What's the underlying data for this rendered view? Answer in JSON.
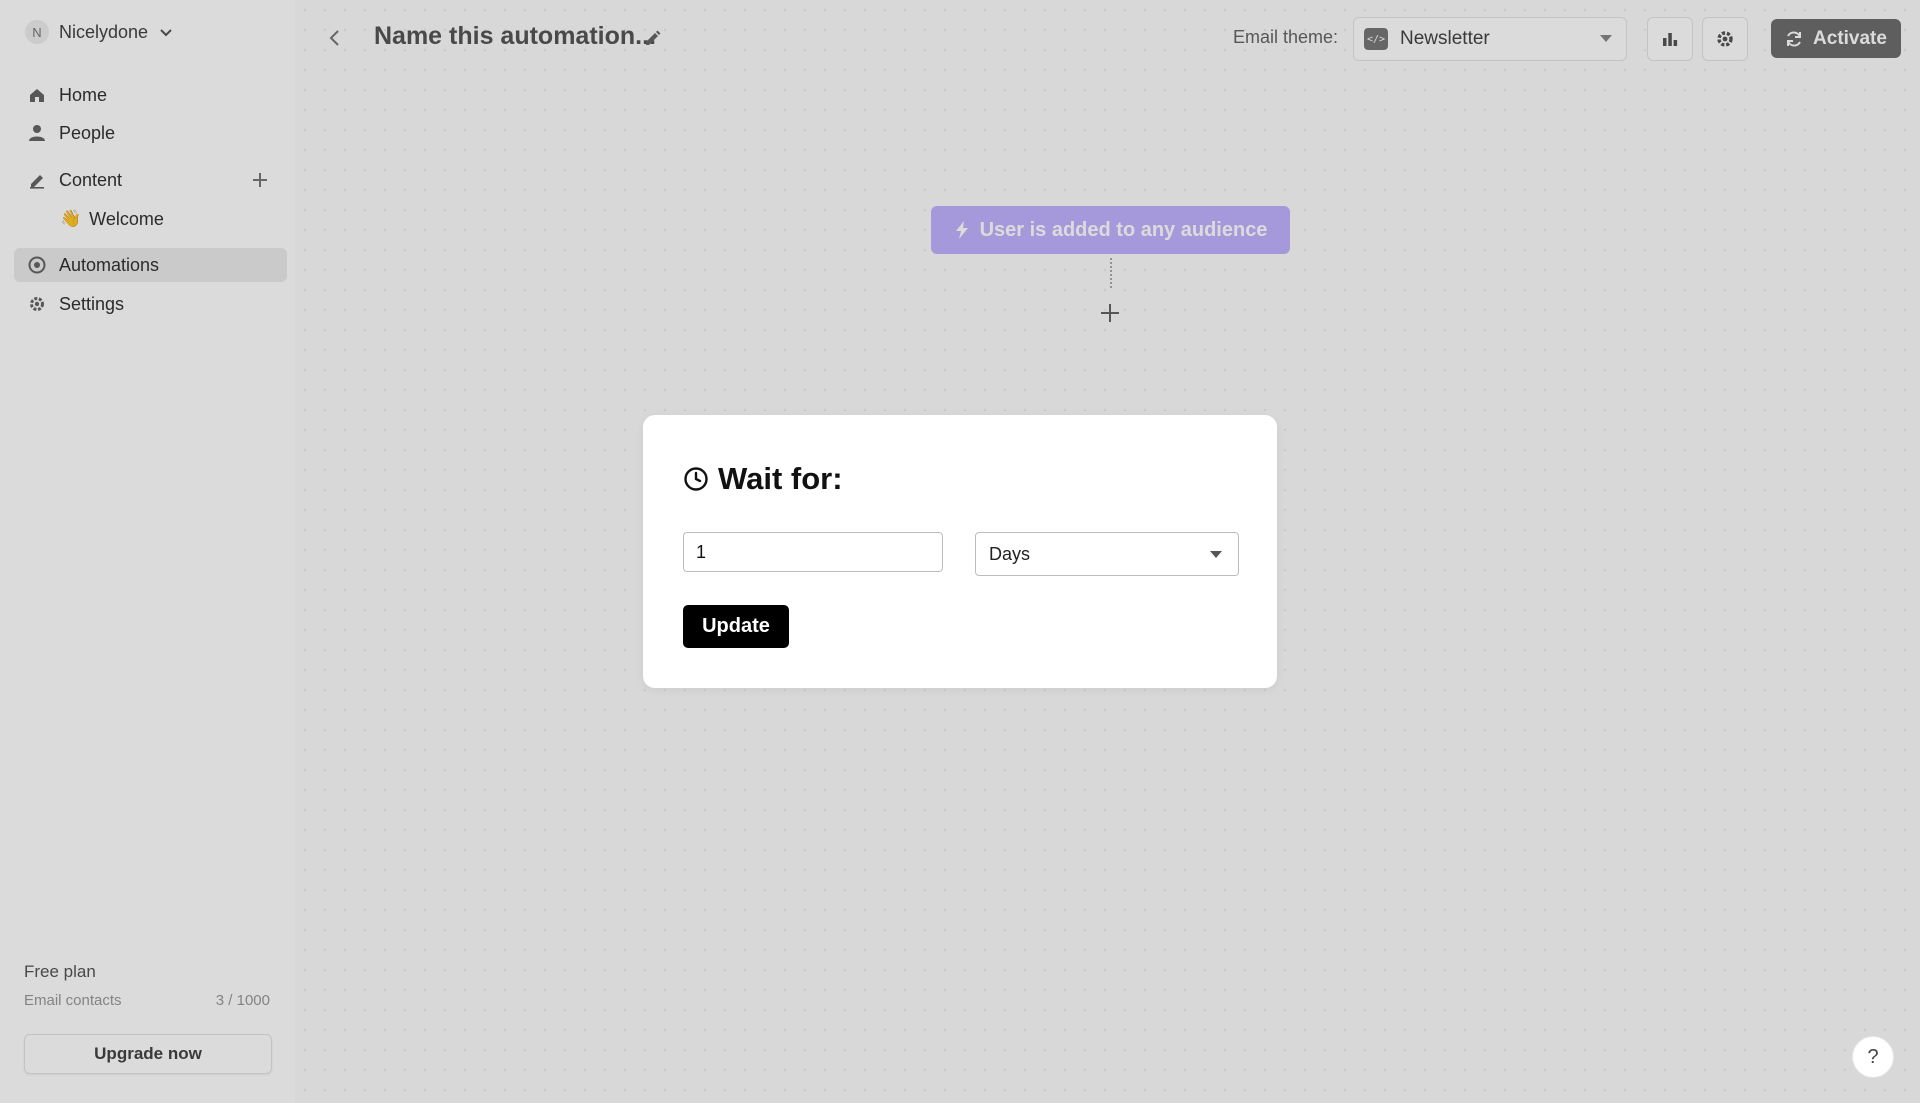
{
  "workspace": {
    "initial": "N",
    "name": "Nicelydone"
  },
  "sidebar": {
    "items": [
      {
        "label": "Home",
        "icon": "home-icon"
      },
      {
        "label": "People",
        "icon": "person-icon"
      },
      {
        "label": "Content",
        "icon": "edit-icon"
      },
      {
        "label": "Welcome",
        "icon": "wave-emoji"
      },
      {
        "label": "Automations",
        "icon": "automation-icon"
      },
      {
        "label": "Settings",
        "icon": "gear-icon"
      }
    ],
    "plan": {
      "title": "Free plan",
      "metric_label": "Email contacts",
      "metric_value": "3 / 1000",
      "upgrade_label": "Upgrade now"
    }
  },
  "topbar": {
    "title": "Name this automation...",
    "theme_label": "Email theme:",
    "theme_value": "Newsletter",
    "theme_code_glyph": "</>",
    "activate_label": "Activate"
  },
  "canvas": {
    "trigger_label": "User is added to any audience",
    "trigger_color": "#c2b3ff"
  },
  "modal": {
    "title": "Wait for:",
    "amount": "1",
    "unit": "Days",
    "update_label": "Update"
  },
  "help_label": "?"
}
